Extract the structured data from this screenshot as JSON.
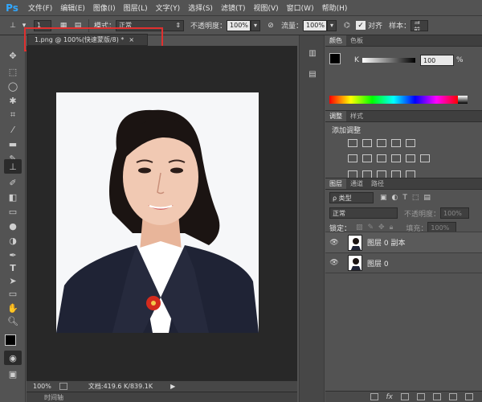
{
  "app": {
    "logo": "Ps",
    "menus": [
      "文件(F)",
      "编辑(E)",
      "图像(I)",
      "图层(L)",
      "文字(Y)",
      "选择(S)",
      "滤镜(T)",
      "视图(V)",
      "窗口(W)",
      "帮助(H)"
    ]
  },
  "options": {
    "size_value": "1",
    "mode_label": "模式：",
    "mode_value": "正常",
    "opacity_label": "不透明度：",
    "opacity_value": "100%",
    "flow_label": "流量：",
    "flow_value": "100%",
    "align_label": "对齐",
    "sample_label": "样本：",
    "sample_value": "当前"
  },
  "document": {
    "tab_title": "1.png @ 100%(快速蒙版/8) *",
    "tab_close": "×",
    "zoom": "100%",
    "doc_info": "文档:419.6 K/839.1K",
    "timeline_label": "时间轴"
  },
  "color_panel": {
    "tabs": [
      "颜色",
      "色板"
    ],
    "channel_label": "K",
    "value": "100",
    "unit": "%"
  },
  "adjust_panel": {
    "tabs": [
      "调整",
      "样式"
    ],
    "heading": "添加调整"
  },
  "layers_panel": {
    "tabs": [
      "图层",
      "通道",
      "路径"
    ],
    "filter_label": "ρ 类型",
    "blend_mode": "正常",
    "opacity_label": "不透明度：",
    "opacity_value": "100%",
    "lock_label": "锁定：",
    "fill_label": "填充：",
    "fill_value": "100%",
    "layers": [
      {
        "name": "图层 0 副本"
      },
      {
        "name": "图层 0"
      }
    ],
    "fx_label": "fx"
  },
  "colors": {
    "accent": "#31a8ff",
    "highlight_box": "#e0302f",
    "canvas_bg": "#282828"
  }
}
